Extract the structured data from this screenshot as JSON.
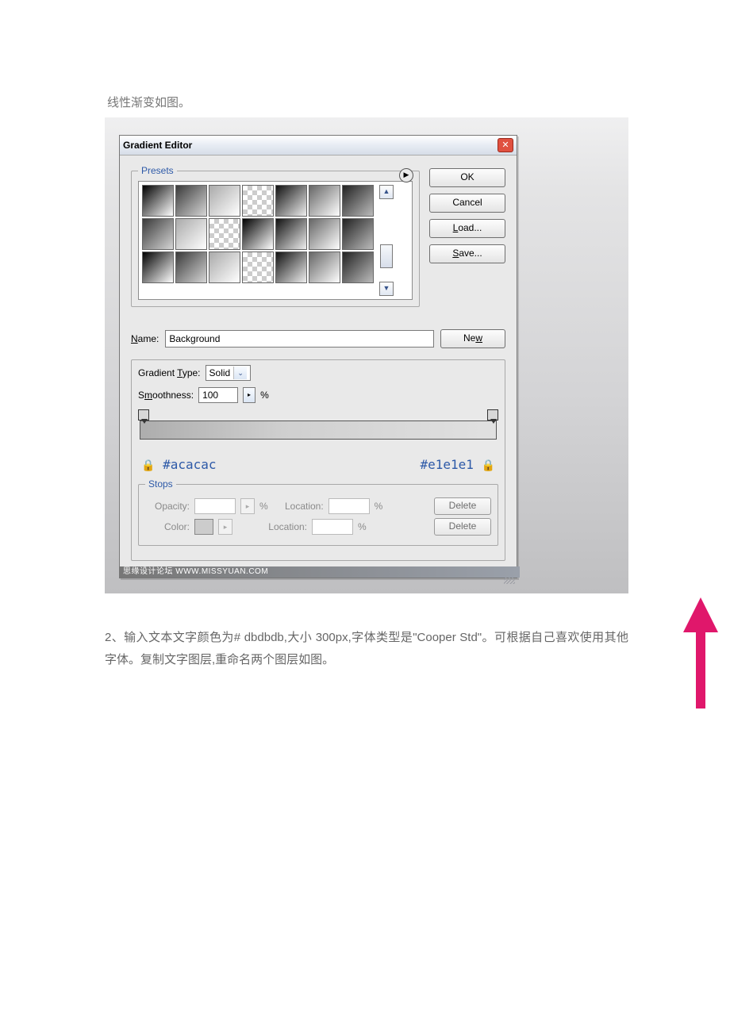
{
  "caption": "线性渐变如图。",
  "dialog": {
    "title": "Gradient Editor",
    "presets_legend": "Presets",
    "buttons": {
      "ok": "OK",
      "cancel": "Cancel",
      "load": "Load...",
      "save": "Save...",
      "new": "New"
    },
    "name_label": "Name:",
    "name_value": "Background",
    "gradient_type_label": "Gradient Type:",
    "gradient_type_value": "Solid",
    "smoothness_label": "Smoothness:",
    "smoothness_value": "100",
    "smoothness_unit": "%",
    "annotation_left": "#acacac",
    "annotation_right": "#e1e1e1",
    "stops_legend": "Stops",
    "opacity_label": "Opacity:",
    "color_label": "Color:",
    "location_label": "Location:",
    "percent": "%",
    "delete": "Delete"
  },
  "watermark": "思缘设计论坛  WWW.MISSYUAN.COM",
  "paragraph2": "2、输入文本文字颜色为# dbdbdb,大小 300px,字体类型是\"Cooper Std\"。可根据自己喜欢使用其他字体。复制文字图层,重命名两个图层如图。",
  "colors": {
    "arrow": "#e0176b"
  }
}
